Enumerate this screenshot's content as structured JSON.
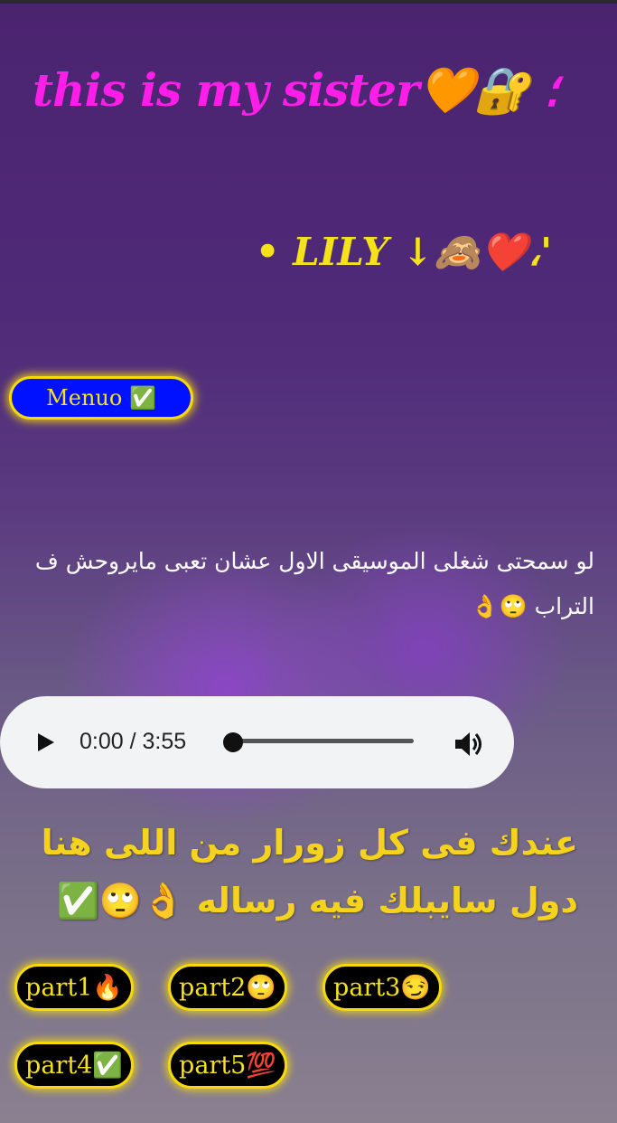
{
  "header": {
    "title": "this is my sister🧡🔐 ؛"
  },
  "name_line": "• LILY ↓🙈❤️،'",
  "menu_button": "Menuo ✅",
  "message": "لو سمحتى شغلى الموسيقى الاول عشان تعبى مايروحش ف التراب 🙄👌",
  "audio": {
    "time": "0:00 / 3:55",
    "progress": 0
  },
  "info": "عندك فى كل زورار من اللى هنا دول سايبلك فيه رساله 👌🙄✅",
  "parts": [
    "part1🔥",
    "part2🙄",
    "part3😏",
    "part4✅",
    "part5💯"
  ],
  "colors": {
    "title": "#ff1ee8",
    "accent": "#f5e21a",
    "menu_bg": "#0011ff",
    "button_bg": "#000000"
  }
}
